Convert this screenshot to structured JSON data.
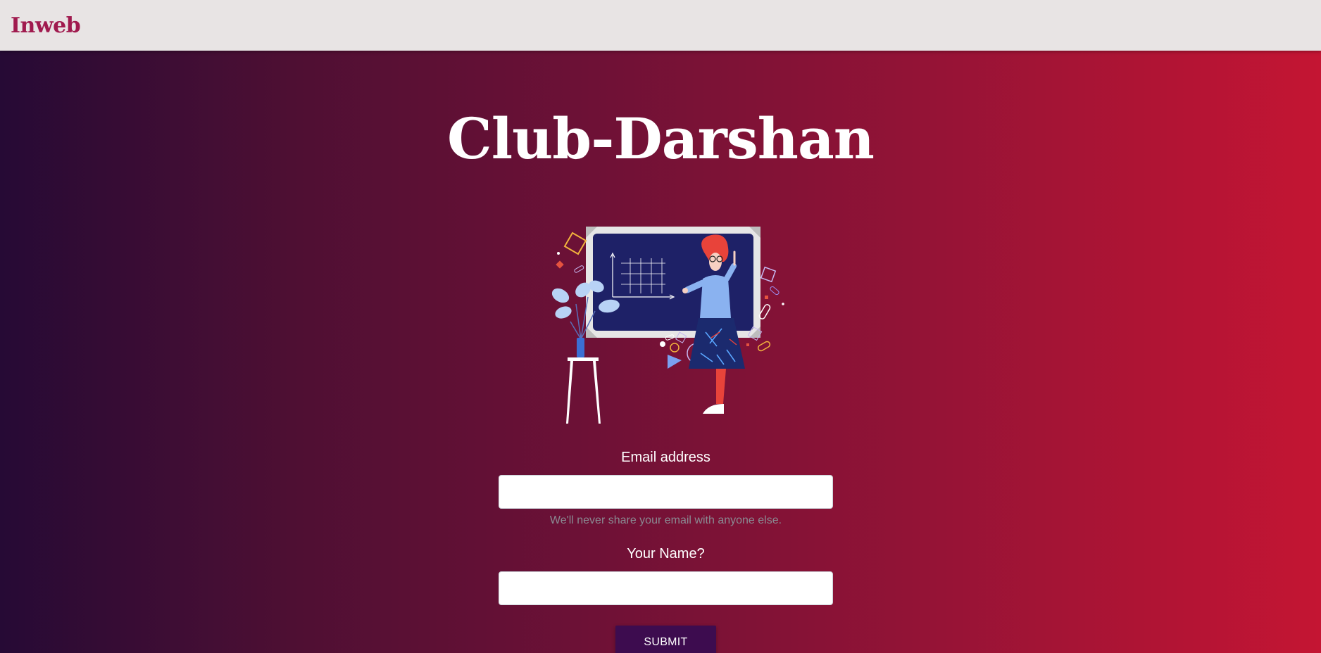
{
  "navbar": {
    "brand": "Inweb"
  },
  "hero": {
    "title": "Club-Darshan",
    "illustration_icon": "teacher-at-blackboard-illustration"
  },
  "form": {
    "email_label": "Email address",
    "email_value": "",
    "email_help": "We'll never share your email with anyone else.",
    "name_label": "Your Name?",
    "name_value": "",
    "submit_label": "SUBMIT"
  },
  "colors": {
    "brand": "#a01a4e",
    "gradient_start": "#260a35",
    "gradient_end": "#c41533",
    "submit_bg": "#3d0c4f"
  }
}
